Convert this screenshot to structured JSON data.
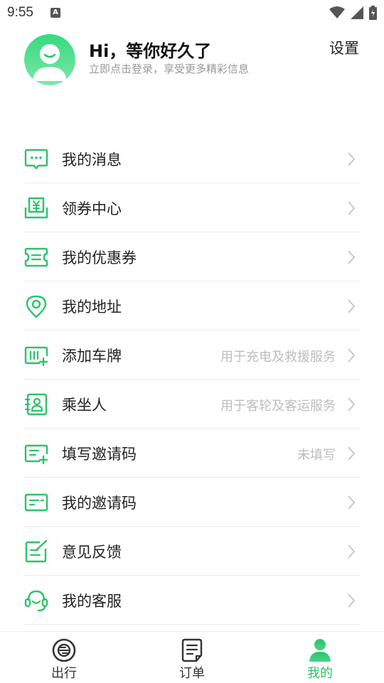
{
  "status_bar": {
    "time": "9:55",
    "notification_badge": "A"
  },
  "profile": {
    "greeting": "Hi，等你好久了",
    "subtitle": "立即点击登录，享受更多精彩信息",
    "settings_label": "设置"
  },
  "menu": [
    {
      "label": "我的消息",
      "hint": "",
      "icon": "message-icon"
    },
    {
      "label": "领券中心",
      "hint": "",
      "icon": "coupon-center-icon"
    },
    {
      "label": "我的优惠券",
      "hint": "",
      "icon": "coupon-icon"
    },
    {
      "label": "我的地址",
      "hint": "",
      "icon": "location-icon"
    },
    {
      "label": "添加车牌",
      "hint": "用于充电及救援服务",
      "icon": "license-plate-icon"
    },
    {
      "label": "乘坐人",
      "hint": "用于客轮及客运服务",
      "icon": "passenger-icon"
    },
    {
      "label": "填写邀请码",
      "hint": "未填写",
      "icon": "fill-invite-code-icon"
    },
    {
      "label": "我的邀请码",
      "hint": "",
      "icon": "invite-code-icon"
    },
    {
      "label": "意见反馈",
      "hint": "",
      "icon": "feedback-icon"
    },
    {
      "label": "我的客服",
      "hint": "",
      "icon": "customer-service-icon"
    }
  ],
  "tabbar": {
    "tabs": [
      {
        "label": "出行",
        "icon": "travel-icon",
        "active": false
      },
      {
        "label": "订单",
        "icon": "order-icon",
        "active": false
      },
      {
        "label": "我的",
        "icon": "profile-icon",
        "active": true
      }
    ]
  },
  "colors": {
    "accent": "#2cc36b",
    "hint": "#bdbdbd",
    "divider": "#eaeaea"
  }
}
